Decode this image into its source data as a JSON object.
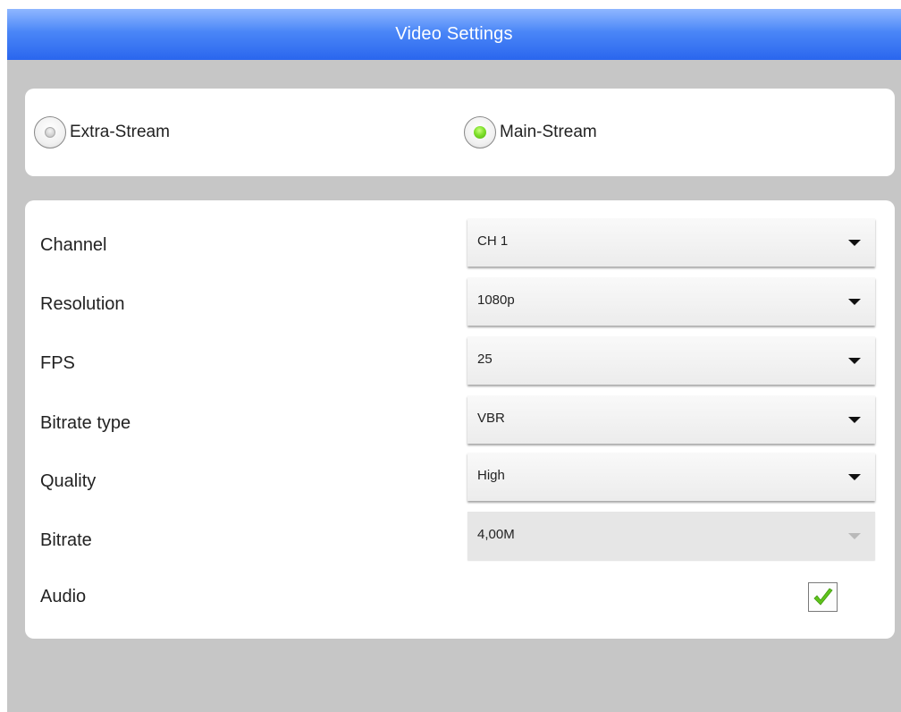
{
  "header": {
    "title": "Video Settings"
  },
  "stream": {
    "options": [
      {
        "label": "Extra-Stream",
        "selected": false
      },
      {
        "label": "Main-Stream",
        "selected": true
      }
    ]
  },
  "settings": {
    "channel": {
      "label": "Channel",
      "value": "CH 1"
    },
    "resolution": {
      "label": "Resolution",
      "value": "1080p"
    },
    "fps": {
      "label": "FPS",
      "value": "25"
    },
    "bitrate_type": {
      "label": "Bitrate type",
      "value": "VBR"
    },
    "quality": {
      "label": "Quality",
      "value": "High"
    },
    "bitrate": {
      "label": "Bitrate",
      "value": "4,00M",
      "enabled": false
    },
    "audio": {
      "label": "Audio",
      "checked": true
    }
  },
  "colors": {
    "title_bar": "#4a86f7",
    "background": "#c6c6c6",
    "radio_selected": "#7fe02b",
    "check_mark": "#5fc21a"
  },
  "icons": {
    "dropdown": "triangle-down-icon",
    "audio_check": "checkmark-icon"
  }
}
